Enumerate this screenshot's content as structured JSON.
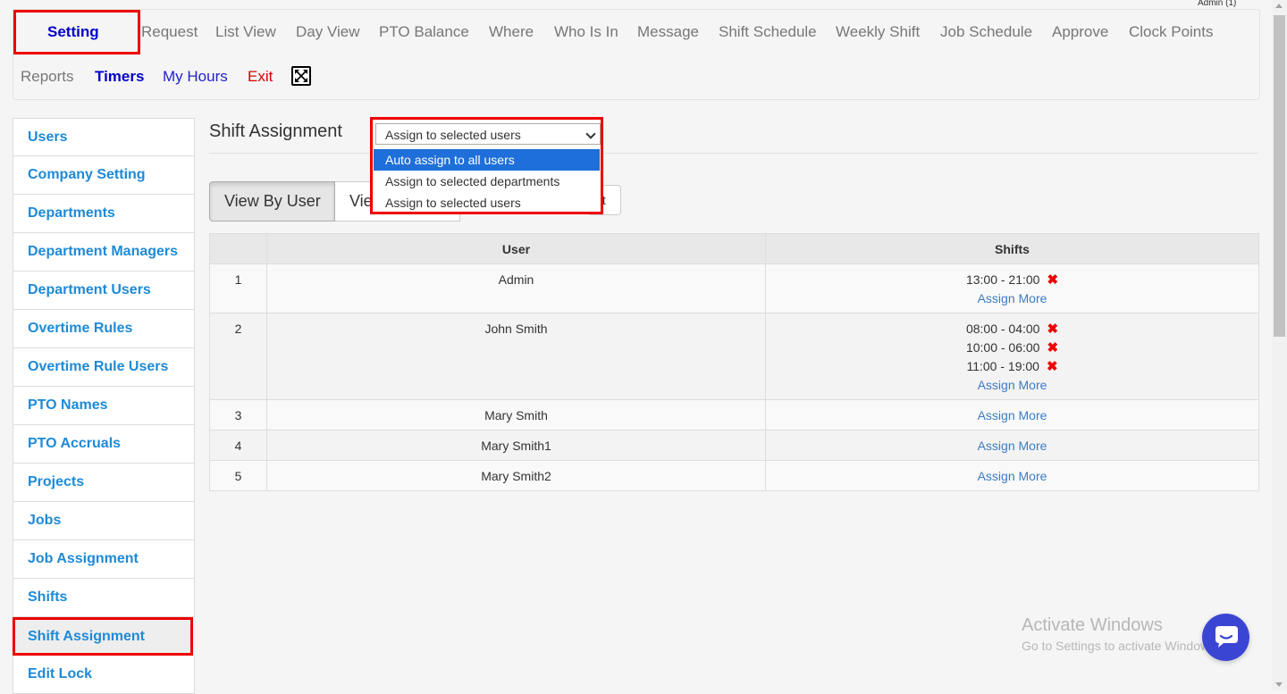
{
  "header": {
    "admin_label": "Admin (1)",
    "nav_row1": [
      "Setting",
      "Request",
      "List View",
      "Day View",
      "PTO Balance",
      "Where",
      "Who Is In",
      "Message",
      "Shift Schedule",
      "Weekly Shift",
      "Job Schedule",
      "Approve",
      "Clock Points"
    ],
    "nav_row2": [
      "Reports",
      "Timers",
      "My Hours",
      "Exit"
    ]
  },
  "sidebar": {
    "items": [
      {
        "label": "Users"
      },
      {
        "label": "Company Setting"
      },
      {
        "label": "Departments"
      },
      {
        "label": "Department Managers"
      },
      {
        "label": "Department Users"
      },
      {
        "label": "Overtime Rules"
      },
      {
        "label": "Overtime Rule Users"
      },
      {
        "label": "PTO Names"
      },
      {
        "label": "PTO Accruals"
      },
      {
        "label": "Projects"
      },
      {
        "label": "Jobs"
      },
      {
        "label": "Job Assignment"
      },
      {
        "label": "Shifts"
      },
      {
        "label": "Shift Assignment",
        "active": true
      },
      {
        "label": "Edit Lock"
      }
    ]
  },
  "main": {
    "title": "Shift Assignment",
    "assign_select": {
      "selected": "Assign to selected users",
      "options": [
        "Auto assign to all users",
        "Assign to selected departments",
        "Assign to selected users"
      ],
      "highlighted": "Auto assign to all users"
    },
    "view_buttons": {
      "by_user": "View By User",
      "second": "Vie",
      "third": "ft"
    },
    "table": {
      "columns": [
        "",
        "User",
        "Shifts"
      ],
      "rows": [
        {
          "num": "1",
          "user": "Admin",
          "shifts": [
            "13:00 - 21:00"
          ]
        },
        {
          "num": "2",
          "user": "John Smith",
          "shifts": [
            "08:00 - 04:00",
            "10:00 - 06:00",
            "11:00 - 19:00"
          ]
        },
        {
          "num": "3",
          "user": "Mary Smith",
          "shifts": []
        },
        {
          "num": "4",
          "user": "Mary Smith1",
          "shifts": []
        },
        {
          "num": "5",
          "user": "Mary Smith2",
          "shifts": []
        }
      ],
      "assign_more_label": "Assign More",
      "remove_icon": "✖"
    }
  },
  "watermark": {
    "line1": "Activate Windows",
    "line2": "Go to Settings to activate Windows."
  },
  "colors": {
    "accent_blue": "#1e8ad6",
    "highlight_red": "#e00000",
    "selected_option": "#1e6fd9",
    "chat_button": "#3b45d4"
  }
}
